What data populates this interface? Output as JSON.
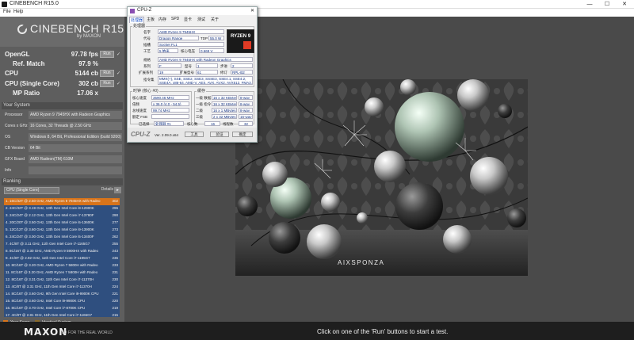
{
  "window": {
    "title": "CINEBENCH R15.0",
    "controls": [
      "—",
      "☐",
      "✕"
    ]
  },
  "menu": [
    "File",
    "Help"
  ],
  "logo": {
    "title": "CINEBENCH R15",
    "subtitle": "by MAXON"
  },
  "scores": [
    {
      "label": "OpenGL",
      "value": "97.78 fps",
      "run": "Run",
      "check": "✓"
    },
    {
      "label": "Ref. Match",
      "value": "97.9 %",
      "run": "",
      "check": ""
    },
    {
      "label": "CPU",
      "value": "5144 cb",
      "run": "Run",
      "check": "✓"
    },
    {
      "label": "CPU (Single Core)",
      "value": "302 cb",
      "run": "Run",
      "check": "✓"
    },
    {
      "label": "MP Ratio",
      "value": "17.06 x",
      "run": "",
      "check": ""
    }
  ],
  "your_system": {
    "header": "Your System",
    "rows": [
      {
        "k": "Processor",
        "v": "AMD Ryzen 9 7945HX with Radeon Graphics"
      },
      {
        "k": "Cores x GHz",
        "v": "16 Cores, 32 Threads @ 2.50 GHz"
      },
      {
        "k": "OS",
        "v": "Windows 8, 64 Bit, Professional Edition (build 9200)"
      },
      {
        "k": "CB Version",
        "v": "64 Bit"
      },
      {
        "k": "GFX Board",
        "v": "AMD Radeon(TM) 610M"
      },
      {
        "k": "Info",
        "v": ""
      }
    ]
  },
  "ranking": {
    "header": "Ranking",
    "select": "CPU (Single Core)",
    "details": "Details",
    "details_btn": "▸",
    "items": [
      {
        "text": "1. 16C/32T @ 2.50 GHz, AMD Ryzen 9 7945HX with Radeo",
        "score": "302",
        "kind": "mine"
      },
      {
        "text": "2. 24C/32T @ 3.19 GHz, 13th Gen Intel Core i9-12900K",
        "score": "296",
        "kind": ""
      },
      {
        "text": "3. 24C/24T @ 2.12 GHz, 13th Gen Intel Core i7-13780F",
        "score": "290",
        "kind": ""
      },
      {
        "text": "4. 20C/20T @ 3.50 GHz, 13th Gen Intel Core i5-13600K",
        "score": "277",
        "kind": ""
      },
      {
        "text": "5. 12C/12T @ 3.60 GHz, 13th Gen Intel Core i9-13900K",
        "score": "273",
        "kind": ""
      },
      {
        "text": "6. 24C/24T @ 3.00 GHz, 13th Gen Intel Core i5-13400F",
        "score": "262",
        "kind": ""
      },
      {
        "text": "7. 4C/8T @ 3.11 GHz, 11th Gen Intel Core i7-1165G7",
        "score": "255",
        "kind": ""
      },
      {
        "text": "8. 8C/16T @ 3.30 GHz, AMD Ryzen 9 5900HX with Radeo",
        "score": "243",
        "kind": ""
      },
      {
        "text": "9. 4C/8T @ 2.92 GHz, 11th Gen Intel Core i7-1195G7",
        "score": "236",
        "kind": ""
      },
      {
        "text": "10. 8C/16T @ 3.20 GHz, AMD Ryzen 7 5800H with Radeo",
        "score": "233",
        "kind": ""
      },
      {
        "text": "11. 8C/16T @ 3.20 GHz, AMD Ryzen 7 5800H with Radeo",
        "score": "231",
        "kind": ""
      },
      {
        "text": "12. 8C/16T @ 3.31 GHz, 11th Gen Intel Core i7-11370H",
        "score": "230",
        "kind": ""
      },
      {
        "text": "13. 4C/8T @ 3.31 GHz, 11th Gen Intel Core i7-11370H",
        "score": "224",
        "kind": ""
      },
      {
        "text": "14. 8C/16T @ 3.60 GHz, 9th Gen Intel Core i9-9900K CPU",
        "score": "221",
        "kind": ""
      },
      {
        "text": "15. 8C/16T @ 3.60 GHz, Intel Core i9-9900K CPU",
        "score": "220",
        "kind": ""
      },
      {
        "text": "16. 8C/16T @ 3.70 GHz, Intel Core i7-8700K CPU",
        "score": "219",
        "kind": ""
      },
      {
        "text": "17. 4C/8T @ 2.81 GHz, 11th Gen Intel Core i7-1165G7",
        "score": "215",
        "kind": ""
      },
      {
        "text": "18. 4C/8T @ 2.40 GHz, Intel Core i7-1065G7 CPU",
        "score": "204",
        "kind": ""
      }
    ]
  },
  "legend": {
    "your_score": "Your Score",
    "identical": "Identical System",
    "your_color": "#d8741b",
    "identical_color": "#8a6a2a"
  },
  "footer": {
    "brand": "MAXON",
    "tagline": "3D FOR THE REAL WORLD",
    "hint": "Click on one of the 'Run' buttons to start a test."
  },
  "render": {
    "watermark": "AIXSPONZA"
  },
  "cpuz": {
    "title": "CPU-Z",
    "close": "✕",
    "tabs": [
      "处理器",
      "主板",
      "内存",
      "SPD",
      "显卡",
      "测试",
      "关于"
    ],
    "group_processor": "处理器",
    "name_lbl": "名字",
    "name_val": "AMD Ryzen 9 7945HX",
    "code_lbl": "代号",
    "code_val": "Dragon Range",
    "tdp_lbl": "TDP",
    "tdp_val": "55.0 W",
    "socket_lbl": "插槽",
    "socket_val": "Socket FL1",
    "tech_lbl": "工艺",
    "tech_val": "5 纳米",
    "volt_lbl": "核心电压",
    "volt_val": "0.669 V",
    "spec_lbl": "规格",
    "spec_val": "AMD Ryzen 9 7945HX with Radeon Graphics",
    "family_lbl": "系列",
    "family_val": "F",
    "model_lbl": "型号",
    "model_val": "1",
    "step_lbl": "步进",
    "step_val": "2",
    "extfam_lbl": "扩展系列",
    "extfam_val": "19",
    "extmodel_lbl": "扩展型号",
    "extmodel_val": "61",
    "rev_lbl": "修订",
    "rev_val": "RPL-B2",
    "instr_lbl": "指令集",
    "instr_val": "MMX(+), SSE, SSE2, SSE3, SSSE3, SSE4.1, SSE4.2, SSE4A, x86-64, AMD-V, AES, AVX, AVX2, AVX512, FMA3, SHA",
    "clock_group": "时钟 (核心 #0)",
    "cache_group": "缓存",
    "core_speed_lbl": "核心速度",
    "core_speed_val": "3590.46 MHz",
    "mult_lbl": "倍频",
    "mult_val": "x 36.0 (4.0 - 54.5)",
    "bus_lbl": "总线速度",
    "bus_val": "99.74 MHz",
    "fsb_lbl": "额定 FSB",
    "fsb_val": "",
    "l1d_lbl": "一级 数据",
    "l1d_val": "16 x 32 KBytes",
    "l1d_way": "8-way",
    "l1i_lbl": "一级 指令",
    "l1i_val": "16 x 32 KBytes",
    "l1i_way": "8-way",
    "l2_lbl": "二级",
    "l2_val": "16 x 1 MBytes",
    "l2_way": "8-way",
    "l3_lbl": "三级",
    "l3_val": "2 x 32 MBytes",
    "l3_way": "16-way",
    "sel_lbl": "已选择",
    "sel_val": "处理器 #1",
    "cores_lbl": "核心数",
    "cores_val": "16",
    "threads_lbl": "线程数",
    "threads_val": "32",
    "brand": "CPU-Z",
    "version": "Ver. 2.09.0.x64",
    "tools_btn": "工具",
    "validate_btn": "验证",
    "ok_btn": "确定",
    "logo_text": "RYZEN 9"
  }
}
